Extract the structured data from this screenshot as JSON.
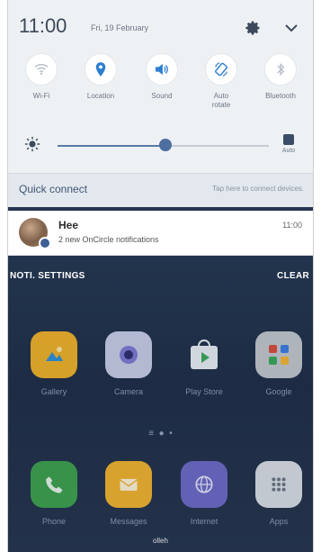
{
  "status": {
    "time": "11:00",
    "date": "Fri, 19 February"
  },
  "quick_settings": [
    {
      "label": "Wi-Fi",
      "icon": "wifi-icon",
      "active": false
    },
    {
      "label": "Location",
      "icon": "location-icon",
      "active": true
    },
    {
      "label": "Sound",
      "icon": "sound-icon",
      "active": true
    },
    {
      "label": "Auto\nrotate",
      "icon": "rotate-icon",
      "active": true
    },
    {
      "label": "Bluetooth",
      "icon": "bluetooth-icon",
      "active": false
    }
  ],
  "brightness": {
    "level": 0.51,
    "auto_label": "Auto"
  },
  "quick_connect": {
    "title": "Quick connect",
    "hint": "Tap here to connect devices."
  },
  "notification": {
    "title": "Hee",
    "text": "2 new OnCircle notifications",
    "time": "11:00"
  },
  "notification_bar": {
    "settings_label": "NOTI. SETTINGS",
    "clear_label": "CLEAR"
  },
  "home_apps_row1": [
    {
      "label": "Gallery",
      "icon": "gallery-icon",
      "color": "#f0b126"
    },
    {
      "label": "Camera",
      "icon": "camera-icon",
      "color": "#7d7ad1"
    },
    {
      "label": "Play Store",
      "icon": "play-store-icon",
      "color": "#e8eef3"
    },
    {
      "label": "Google",
      "icon": "google-folder-icon",
      "color": "#c3c7cc"
    }
  ],
  "home_apps_row2": [
    {
      "label": "Phone",
      "icon": "phone-icon",
      "color": "#3ca04b"
    },
    {
      "label": "Messages",
      "icon": "messages-icon",
      "color": "#f1b22a"
    },
    {
      "label": "Internet",
      "icon": "internet-icon",
      "color": "#6c68c6"
    },
    {
      "label": "Apps",
      "icon": "apps-icon",
      "color": "#d9dde3"
    }
  ],
  "carrier_label": "olleh"
}
